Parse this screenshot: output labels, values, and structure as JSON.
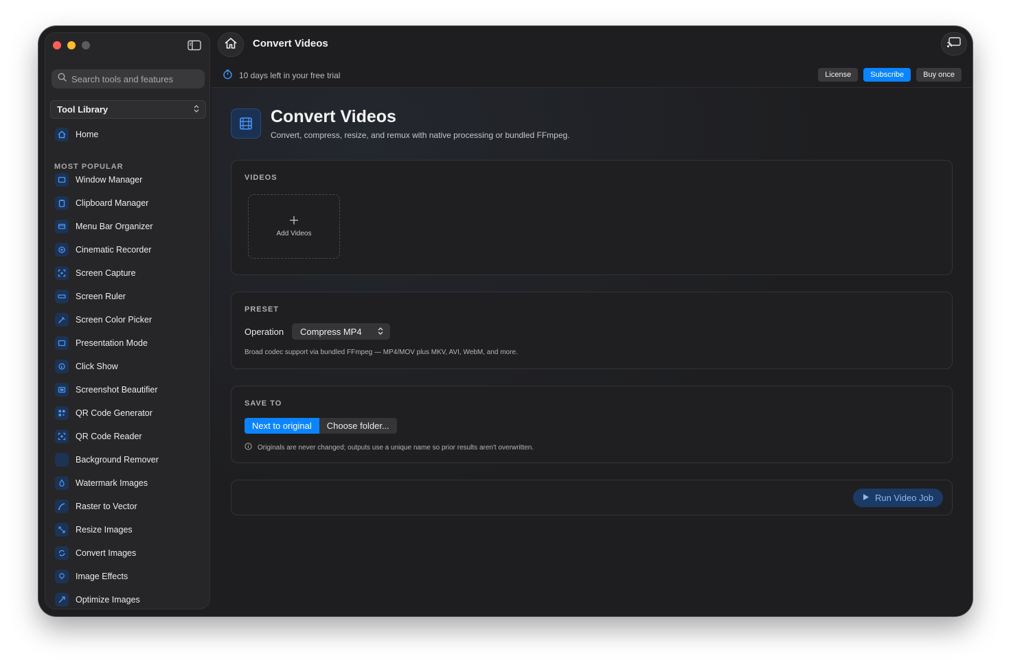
{
  "window": {
    "title": "Convert Videos"
  },
  "sidebar": {
    "search_placeholder": "Search tools and features",
    "library_label": "Tool Library",
    "home_label": "Home",
    "section_label": "MOST POPULAR",
    "items": [
      {
        "label": "Window Manager",
        "icon": "window-icon"
      },
      {
        "label": "Clipboard Manager",
        "icon": "clipboard-icon"
      },
      {
        "label": "Menu Bar Organizer",
        "icon": "menubar-icon"
      },
      {
        "label": "Cinematic Recorder",
        "icon": "camera-icon"
      },
      {
        "label": "Screen Capture",
        "icon": "capture-icon"
      },
      {
        "label": "Screen Ruler",
        "icon": "ruler-icon"
      },
      {
        "label": "Screen Color Picker",
        "icon": "eyedropper-icon"
      },
      {
        "label": "Presentation Mode",
        "icon": "presentation-icon"
      },
      {
        "label": "Click Show",
        "icon": "pointer-icon"
      },
      {
        "label": "Screenshot Beautifier",
        "icon": "image-frame-icon"
      },
      {
        "label": "QR Code Generator",
        "icon": "qr-icon"
      },
      {
        "label": "QR Code Reader",
        "icon": "qr-scan-icon"
      },
      {
        "label": "Background Remover",
        "icon": "background-icon"
      },
      {
        "label": "Watermark Images",
        "icon": "drop-icon"
      },
      {
        "label": "Raster to Vector",
        "icon": "vector-icon"
      },
      {
        "label": "Resize Images",
        "icon": "resize-icon"
      },
      {
        "label": "Convert Images",
        "icon": "convert-icon"
      },
      {
        "label": "Image Effects",
        "icon": "effects-icon"
      },
      {
        "label": "Optimize Images",
        "icon": "optimize-icon"
      }
    ]
  },
  "topbar": {
    "trial_text": "10 days left in your free trial",
    "license_label": "License",
    "subscribe_label": "Subscribe",
    "buy_label": "Buy once"
  },
  "page": {
    "title": "Convert Videos",
    "subtitle": "Convert, compress, resize, and remux with native processing or bundled FFmpeg."
  },
  "videos": {
    "label": "VIDEOS",
    "add_label": "Add Videos"
  },
  "preset": {
    "label": "PRESET",
    "operation_label": "Operation",
    "operation_value": "Compress MP4",
    "note": "Broad codec support via bundled FFmpeg — MP4/MOV plus MKV, AVI, WebM, and more."
  },
  "save_to": {
    "label": "SAVE TO",
    "option_selected": "Next to original",
    "option_other": "Choose folder...",
    "note": "Originals are never changed; outputs use a unique name so prior results aren't overwritten."
  },
  "run": {
    "label": "Run Video Job"
  },
  "colors": {
    "accent": "#0a84ff",
    "background": "#1e1e20",
    "sidebar": "#262628"
  }
}
